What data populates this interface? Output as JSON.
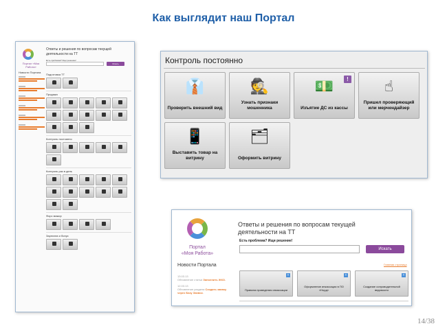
{
  "slide": {
    "title": "Как выглядит наш Портал",
    "page": "14/38"
  },
  "portal": {
    "brand": "Портал «Моя Работа»",
    "brand_line1": "Портал",
    "brand_line2": "«Моя Работа»",
    "header_line1": "Ответы и решения по вопросам текущей",
    "header_line2": "деятельности на ТТ",
    "search_label": "Есть проблема? Ищи решение!",
    "search_placeholder": "",
    "search_button": "Искать",
    "start_page_link": "Главная страница",
    "news_title": "Новости Портала",
    "news": [
      {
        "date": "13.03.13",
        "text": "Обновление статьи ",
        "highlight": "Заполнить ЖКО."
      },
      {
        "date": "12.03.13",
        "text": "Обновление раздела ",
        "highlight": "Создать заявку через Базу Заявок."
      }
    ]
  },
  "full_page": {
    "sections": [
      "Подготовка ТТ",
      "Продажа",
      "Контроль постоянно",
      "Контроль раз в день",
      "Форс мажор",
      "Зарплата и бонус"
    ]
  },
  "control": {
    "title": "Контроль постоянно",
    "tiles": [
      {
        "label": "Проверить внешний вид",
        "icon": "tie-icon",
        "glyph": "👔"
      },
      {
        "label": "Узнать признаки мошенника",
        "icon": "spy-icon",
        "glyph": "🕵"
      },
      {
        "label": "Изъятие ДС из кассы",
        "icon": "cash-icon",
        "glyph": "💵",
        "badge": "!"
      },
      {
        "label": "Пришел проверяющий или мерчендайзер",
        "icon": "pointer-hand-icon",
        "glyph": "☝"
      },
      {
        "label": "Выставить товар на витрину",
        "icon": "phones-icon",
        "glyph": "📱"
      },
      {
        "label": "Оформить витрину",
        "icon": "showcase-icon",
        "glyph": "🗂"
      }
    ]
  },
  "header_tiles": [
    {
      "label": "Правила проведения инкассации",
      "badge": "+"
    },
    {
      "label": "Оформление инкассации в ПО «Норд»",
      "badge": "+"
    },
    {
      "label": "Создание сопроводительной ведомости",
      "badge": "+"
    }
  ],
  "colors": {
    "title": "#1f5fa8",
    "accent_purple": "#8b4a9c",
    "link_orange": "#e87b2c"
  }
}
